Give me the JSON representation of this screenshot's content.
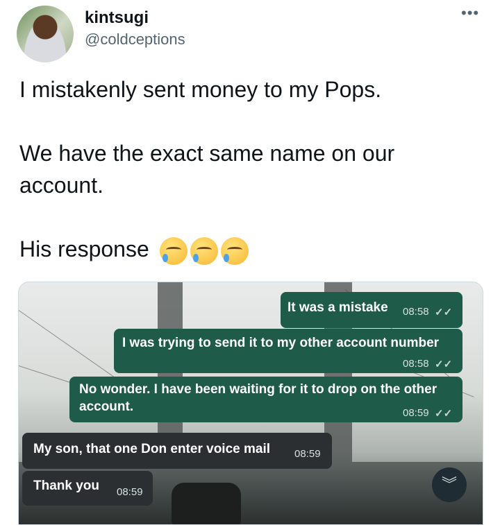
{
  "tweet": {
    "display_name": "kintsugi",
    "handle": "@coldceptions",
    "more_icon": "more-horizontal-icon",
    "lines": [
      "I mistakenly sent money to my Pops.",
      "We have the exact same name on our account.",
      "His response"
    ],
    "emoji": [
      "sad-but-relieved-emoji",
      "sad-but-relieved-emoji",
      "sad-but-relieved-emoji"
    ]
  },
  "chat": {
    "messages": [
      {
        "direction": "out",
        "text": "It was a mistake",
        "time": "08:58",
        "ticks": "✓✓"
      },
      {
        "direction": "out",
        "text": "I was trying to send it to my other account number",
        "time": "08:58",
        "ticks": "✓✓"
      },
      {
        "direction": "out",
        "text_line1": "No wonder. I have been waiting for it to drop on the other",
        "text_line2": "account.",
        "time": "08:59",
        "ticks": "✓✓"
      },
      {
        "direction": "in",
        "text": "My son, that one Don enter voice mail",
        "time": "08:59"
      },
      {
        "direction": "in",
        "text": "Thank you",
        "time": "08:59"
      }
    ],
    "scroll_down_icon": "chevron-double-down-icon"
  }
}
